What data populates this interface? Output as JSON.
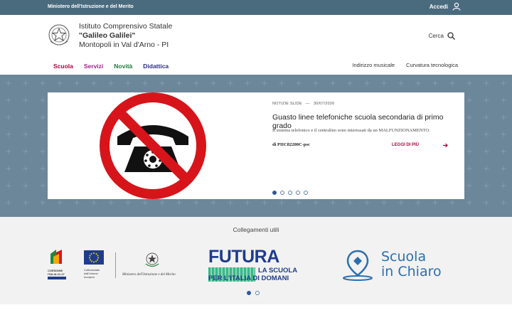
{
  "topbar": {
    "ministry": "Ministero dell'Istruzione e del Merito",
    "login": "Accedi"
  },
  "school": {
    "line1": "Istituto Comprensivo Statale",
    "line2": "\"Galileo Galilei\"",
    "line3": "Montopoli in Val d'Arno - PI"
  },
  "search": {
    "label": "Cerca"
  },
  "nav": {
    "main": [
      {
        "label": "Scuola",
        "color": "#b3003b"
      },
      {
        "label": "Servizi",
        "color": "#a2228a"
      },
      {
        "label": "Novità",
        "color": "#1b7a3e"
      },
      {
        "label": "Didattica",
        "color": "#2d2a8c"
      }
    ],
    "secondary": [
      "Indirizzo musicale",
      "Curvatura tecnologica"
    ]
  },
  "slide": {
    "category": "NOTIZIE SLIDE",
    "date": "30/07/2026",
    "title": "Guasto linee telefoniche scuola secondaria di primo grado",
    "description": "Il sistema telefonico e il centralino sono interessati da un MALFUNZIONAMENTO.",
    "author": "di PIIC82200C-psc",
    "more": "LEGGI DI PIÙ",
    "total_slides": 5,
    "active_slide": 1
  },
  "links": {
    "heading": "Collegamenti utili",
    "coesione": [
      "COESIONE",
      "ITALIA 21-27"
    ],
    "ue": [
      "Cofinanziato",
      "dall'Unione europea"
    ],
    "ministero": "Ministero dell'Istruzione e del Merito",
    "futura": {
      "title": "FUTURA",
      "line1": "LA SCUOLA",
      "line2": "PER L'ITALIA DI DOMANI"
    },
    "scuola_chiaro": [
      "Scuola",
      "in Chiaro"
    ],
    "total_pages": 2,
    "active_page": 1
  },
  "colors": {
    "accent": "#b3003b",
    "topbar": "#4a6b7e",
    "hero": "#6c8799",
    "dot_active": "#2c5aa0"
  }
}
